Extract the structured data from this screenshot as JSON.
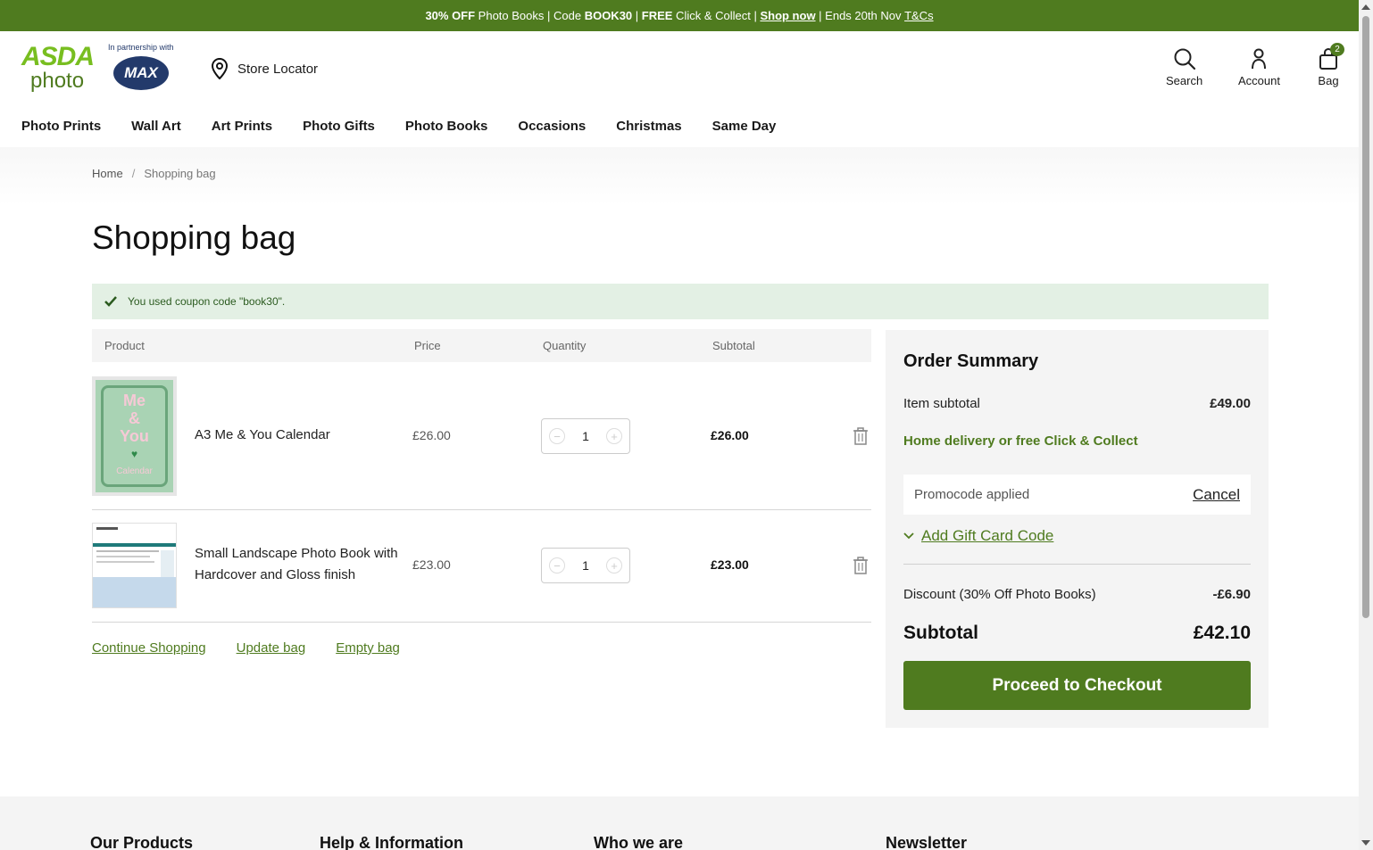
{
  "promo_bar": {
    "part1_bold": "30% OFF",
    "part1": " Photo Books | Code ",
    "code": "BOOK30",
    "part2": " | ",
    "free": "FREE",
    "part3": " Click & Collect | ",
    "shop_now": "Shop now",
    "part4": " | Ends 20th Nov ",
    "tcs": "T&Cs"
  },
  "header": {
    "logo_line1": "ASDA",
    "logo_line2": "photo",
    "partner_text": "In partnership with",
    "partner_logo": "MAX",
    "store_locator": "Store Locator",
    "search_label": "Search",
    "account_label": "Account",
    "bag_label": "Bag",
    "bag_count": "2"
  },
  "nav": {
    "items": [
      "Photo Prints",
      "Wall Art",
      "Art Prints",
      "Photo Gifts",
      "Photo Books",
      "Occasions",
      "Christmas",
      "Same Day"
    ]
  },
  "breadcrumb": {
    "home": "Home",
    "sep": "/",
    "current": "Shopping bag"
  },
  "page_title": "Shopping bag",
  "notice": "You used coupon code \"book30\".",
  "table": {
    "headers": {
      "product": "Product",
      "price": "Price",
      "quantity": "Quantity",
      "subtotal": "Subtotal"
    },
    "rows": [
      {
        "name": "A3 Me & You Calendar",
        "price": "£26.00",
        "qty": "1",
        "subtotal": "£26.00",
        "thumb_text1": "Me",
        "thumb_text2": "&",
        "thumb_text3": "You",
        "thumb_text4": "Calendar"
      },
      {
        "name": "Small Landscape Photo Book with Hardcover and Gloss finish",
        "price": "£23.00",
        "qty": "1",
        "subtotal": "£23.00"
      }
    ]
  },
  "actions": {
    "continue": "Continue Shopping",
    "update": "Update bag",
    "empty": "Empty bag"
  },
  "summary": {
    "title": "Order Summary",
    "item_subtotal_label": "Item subtotal",
    "item_subtotal_value": "£49.00",
    "delivery": "Home delivery or free Click & Collect",
    "promo_applied": "Promocode applied",
    "cancel": "Cancel",
    "gift_card": "Add Gift Card Code",
    "discount_label": "Discount (30% Off Photo Books)",
    "discount_value": "-£6.90",
    "subtotal_label": "Subtotal",
    "subtotal_value": "£42.10",
    "checkout": "Proceed to Checkout"
  },
  "footer": {
    "col1": "Our Products",
    "col2": "Help & Information",
    "col3": "Who we are",
    "col4": "Newsletter"
  },
  "colors": {
    "brand_green": "#4f7b1f",
    "logo_green": "#78be20",
    "notice_bg": "#e3f0e4",
    "partner_navy": "#233a6b"
  }
}
